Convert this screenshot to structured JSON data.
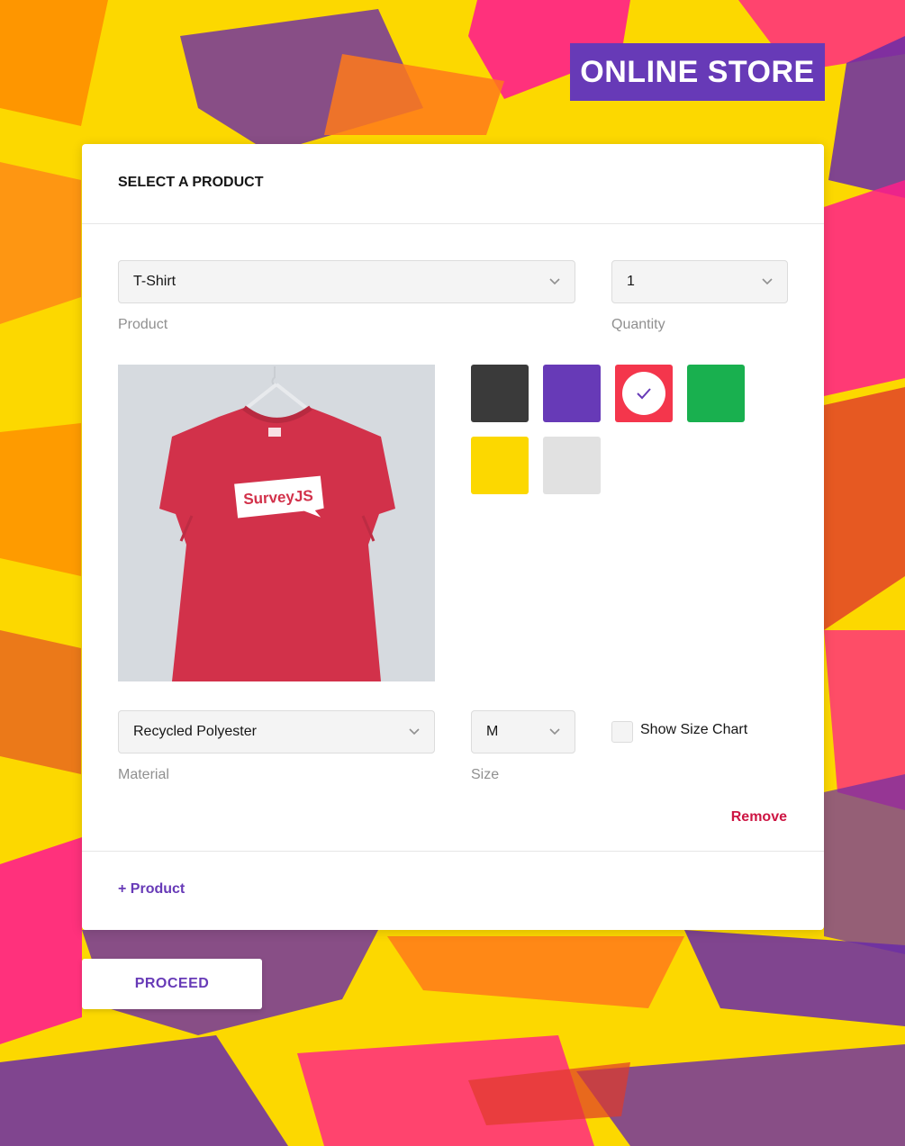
{
  "header": {
    "badge": "ONLINE STORE"
  },
  "card": {
    "title": "SELECT A PRODUCT",
    "product": {
      "value": "T-Shirt",
      "label": "Product"
    },
    "quantity": {
      "value": "1",
      "label": "Quantity"
    },
    "image": {
      "alt": "Red t-shirt on hanger",
      "logo_text": "SurveyJS"
    },
    "colors": [
      {
        "name": "dark-gray",
        "hex": "#3a3a3a",
        "selected": false
      },
      {
        "name": "purple",
        "hex": "#673ab7",
        "selected": false
      },
      {
        "name": "red",
        "hex": "#f4364c",
        "selected": true
      },
      {
        "name": "green",
        "hex": "#19b04f",
        "selected": false
      },
      {
        "name": "yellow",
        "hex": "#fcd800",
        "selected": false
      },
      {
        "name": "light-gray",
        "hex": "#e1e1e1",
        "selected": false
      }
    ],
    "material": {
      "value": "Recycled Polyester",
      "label": "Material"
    },
    "size": {
      "value": "M",
      "label": "Size"
    },
    "size_chart": {
      "label": "Show Size Chart",
      "checked": false
    },
    "remove_label": "Remove",
    "add_product_label": "+ Product"
  },
  "footer": {
    "proceed_label": "PROCEED"
  },
  "theme": {
    "accent": "#673ab7",
    "danger": "#cd1543",
    "background": "#fcd800"
  }
}
